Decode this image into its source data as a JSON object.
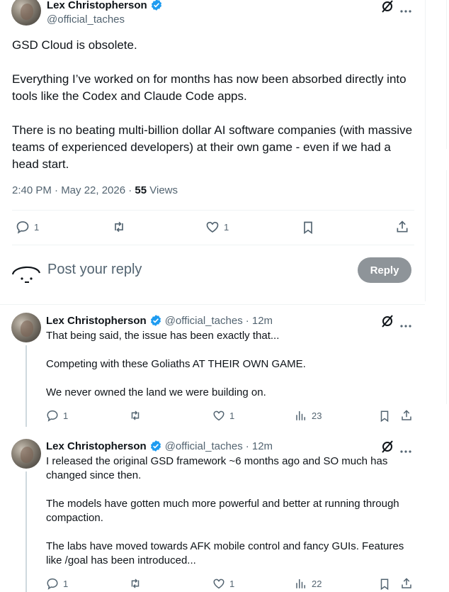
{
  "main_post": {
    "author_name": "Lex Christopherson",
    "author_handle": "@official_taches",
    "paragraphs": [
      "GSD Cloud is obsolete.",
      "Everything I’ve worked on for months has now been absorbed directly into tools like the Codex and Claude Code apps.",
      "There is no beating multi-billion dollar AI software companies (with massive teams of experienced developers) at their own game - even if we had a head start."
    ],
    "timestamp": "2:40 PM · May 22, 2026 · ",
    "views_count": "55",
    "views_label": " Views",
    "reply_count": "1",
    "like_count": "1"
  },
  "composer": {
    "placeholder": "Post your reply",
    "button_label": "Reply"
  },
  "replies": [
    {
      "author_name": "Lex Christopherson",
      "author_handle": "@official_taches",
      "time": " · 12m",
      "paragraphs": [
        "That being said, the issue has been exactly that...",
        "Competing with these Goliaths AT THEIR OWN GAME.",
        "We never owned the land we were building on."
      ],
      "reply_count": "1",
      "like_count": "1",
      "views": "23"
    },
    {
      "author_name": "Lex Christopherson",
      "author_handle": "@official_taches",
      "time": " · 12m",
      "paragraphs": [
        "I released the original GSD framework ~6 months ago and SO much has changed since then.",
        "The models have gotten much more powerful and better at running through compaction.",
        "The labs have moved towards AFK mobile control and fancy GUIs. Features like /goal has been introduced..."
      ],
      "reply_count": "1",
      "like_count": "1",
      "views": "22"
    }
  ],
  "icons": {
    "verified": "verified-badge-icon",
    "grok": "grok-icon",
    "more": "more-icon",
    "reply": "reply-icon",
    "repost": "repost-icon",
    "like": "like-icon",
    "bookmark": "bookmark-icon",
    "share": "share-icon",
    "views": "views-icon"
  },
  "colors": {
    "verified_blue": "#1d9bf0",
    "secondary_text": "#536471",
    "reply_button_bg": "#8e9499"
  }
}
